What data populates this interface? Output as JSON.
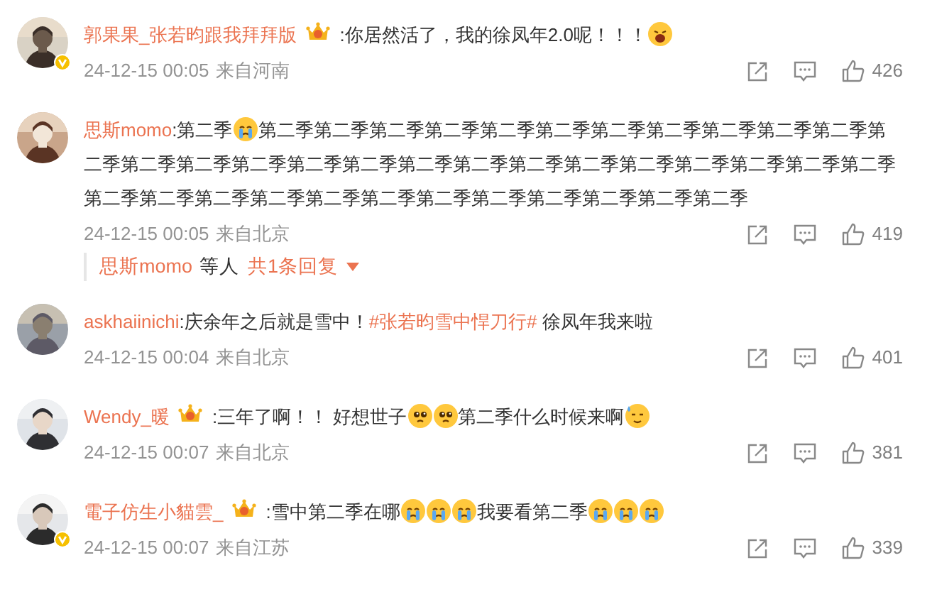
{
  "comments": [
    {
      "user": "郭果果_张若昀跟我拜拜版",
      "badge": true,
      "verified": true,
      "content": [
        {
          "kind": "text",
          "text": ":你居然活了，我的徐凤年2.0呢！！！"
        },
        {
          "kind": "shout"
        }
      ],
      "time": "24-12-15 00:05",
      "location": "来自河南",
      "likes": "426"
    },
    {
      "user": "思斯momo",
      "badge": false,
      "verified": false,
      "content": [
        {
          "kind": "text",
          "text": ":第二季"
        },
        {
          "kind": "cry"
        },
        {
          "kind": "text",
          "text": "第二季第二季第二季第二季第二季第二季第二季第二季第二季第二季第二季第二季第二季第二季第二季第二季第二季第二季第二季第二季第二季第二季第二季第二季第二季第二季第二季第二季第二季第二季第二季第二季第二季第二季第二季第二季第二季第二季"
        }
      ],
      "time": "24-12-15 00:05",
      "location": "来自北京",
      "likes": "419",
      "replies": {
        "user": "思斯momo",
        "suffix": "等人",
        "count": "共1条回复"
      }
    },
    {
      "user": "askhaiinichi",
      "badge": false,
      "verified": false,
      "content": [
        {
          "kind": "text",
          "text": ":庆余年之后就是雪中！"
        },
        {
          "kind": "hashtag",
          "text": "#张若昀雪中悍刀行#"
        },
        {
          "kind": "text",
          "text": " 徐凤年我来啦"
        }
      ],
      "time": "24-12-15 00:04",
      "location": "来自北京",
      "likes": "401"
    },
    {
      "user": "Wendy_暖",
      "badge": true,
      "verified": false,
      "content": [
        {
          "kind": "text",
          "text": ":三年了啊！！ 好想世子"
        },
        {
          "kind": "pleading"
        },
        {
          "kind": "pleading"
        },
        {
          "kind": "text",
          "text": "第二季什么时候来啊"
        },
        {
          "kind": "sweat"
        }
      ],
      "time": "24-12-15 00:07",
      "location": "来自北京",
      "likes": "381"
    },
    {
      "user": "電子仿生小貓雲_",
      "badge": true,
      "verified": true,
      "content": [
        {
          "kind": "text",
          "text": ":雪中第二季在哪"
        },
        {
          "kind": "cry"
        },
        {
          "kind": "cry"
        },
        {
          "kind": "cry"
        },
        {
          "kind": "text",
          "text": "我要看第二季"
        },
        {
          "kind": "cry"
        },
        {
          "kind": "cry"
        },
        {
          "kind": "cry"
        }
      ],
      "time": "24-12-15 00:07",
      "location": "来自江苏",
      "likes": "339"
    }
  ]
}
